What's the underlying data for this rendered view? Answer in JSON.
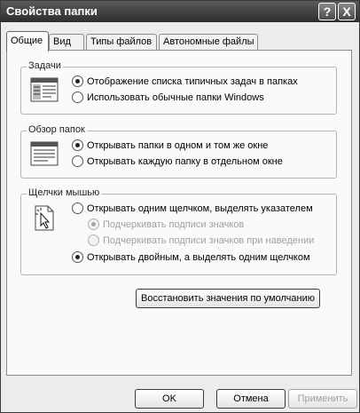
{
  "window": {
    "title": "Свойства папки",
    "help_button": "?",
    "close_button": "X"
  },
  "tabs": [
    {
      "label": "Общие",
      "active": true
    },
    {
      "label": "Вид",
      "active": false
    },
    {
      "label": "Типы файлов",
      "active": false
    },
    {
      "label": "Автономные файлы",
      "active": false
    }
  ],
  "tasks": {
    "title": "Задачи",
    "icon": "folder-tasks-icon",
    "options": [
      {
        "label": "Отображение списка типичных задач в папках",
        "checked": true
      },
      {
        "label": "Использовать обычные папки Windows",
        "checked": false
      }
    ]
  },
  "browse": {
    "title": "Обзор папок",
    "icon": "folder-window-icon",
    "options": [
      {
        "label": "Открывать папки в одном и том же окне",
        "checked": true
      },
      {
        "label": "Открывать каждую папку в отдельном окне",
        "checked": false
      }
    ]
  },
  "clicks": {
    "title": "Щелчки мышью",
    "icon": "pointer-click-icon",
    "single": {
      "label": "Открывать одним щелчком, выделять указателем",
      "checked": false
    },
    "underline": [
      {
        "label": "Подчеркивать подписи значков",
        "checked": true,
        "disabled": true
      },
      {
        "label": "Подчеркивать подписи значков при наведении",
        "checked": false,
        "disabled": true
      }
    ],
    "double": {
      "label": "Открывать двойным, а выделять одним щелчком",
      "checked": true
    }
  },
  "restore_defaults": "Восстановить значения по умолчанию",
  "footer": {
    "ok": "OK",
    "cancel": "Отмена",
    "apply": "Применить"
  }
}
